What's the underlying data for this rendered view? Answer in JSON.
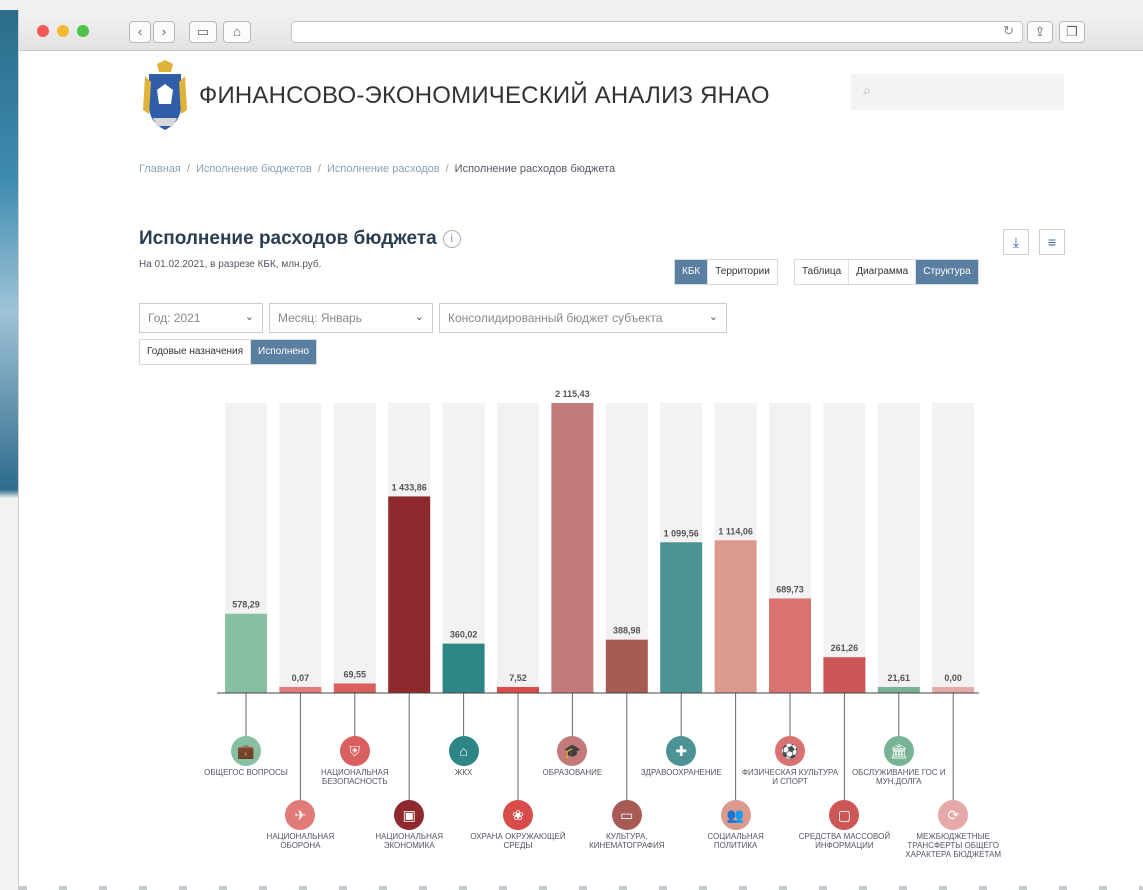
{
  "site": {
    "title": "ФИНАНСОВО-ЭКОНОМИЧЕСКИЙ АНАЛИЗ ЯНАО"
  },
  "breadcrumb": [
    "Главная",
    "Исполнение бюджетов",
    "Исполнение расходов",
    "Исполнение расходов бюджета"
  ],
  "page": {
    "title": "Исполнение расходов бюджета",
    "info": "i",
    "subtitle": "На 01.02.2021, в разрезе КБК, млн.руб."
  },
  "view_tabs": {
    "kbk": "КБК",
    "territories": "Территории"
  },
  "display_tabs": {
    "table": "Таблица",
    "diagram": "Диаграмма",
    "structure": "Структура"
  },
  "filters": {
    "year": "Год: 2021",
    "month": "Месяц: Январь",
    "budget": "Консолидированный бюджет субъекта"
  },
  "mode_tabs": {
    "plan": "Годовые назначения",
    "done": "Исполнено"
  },
  "icons": {
    "download": "download-icon",
    "menu": "list-icon",
    "search": "search-icon"
  },
  "chart_data": {
    "type": "bar",
    "categories": [
      "ОБЩЕГОС ВОПРОСЫ",
      "НАЦИОНАЛЬНАЯ ОБОРОНА",
      "НАЦИОНАЛЬНАЯ БЕЗОПАСНОСТЬ",
      "НАЦИОНАЛЬНАЯ ЭКОНОМИКА",
      "ЖКХ",
      "ОХРАНА ОКРУЖАЮЩЕЙ СРЕДЫ",
      "ОБРАЗОВАНИЕ",
      "КУЛЬТУРА, КИНЕМАТОГРАФИЯ",
      "ЗДРАВООХРАНЕНИЕ",
      "СОЦИАЛЬНАЯ ПОЛИТИКА",
      "ФИЗИЧЕСКАЯ КУЛЬТУРА И СПОРТ",
      "СРЕДСТВА МАССОВОЙ ИНФОРМАЦИИ",
      "ОБСЛУЖИВАНИЕ ГОС И МУН.ДОЛГА",
      "МЕЖБЮДЖЕТНЫЕ ТРАНСФЕРТЫ ОБЩЕГО ХАРАКТЕРА БЮДЖЕТАМ"
    ],
    "values": [
      578.29,
      0.07,
      69.55,
      1433.86,
      360.02,
      7.52,
      2115.43,
      388.98,
      1099.56,
      1114.06,
      689.73,
      261.26,
      21.61,
      0.0
    ],
    "value_labels": [
      "578,29",
      "0,07",
      "69,55",
      "1 433,86",
      "360,02",
      "7,52",
      "2 115,43",
      "388,98",
      "1 099,56",
      "1 114,06",
      "689,73",
      "261,26",
      "21,61",
      "0,00"
    ],
    "colors": [
      "#86bfa2",
      "#e07b78",
      "#d9605e",
      "#8e2a2e",
      "#2e8585",
      "#d84d4b",
      "#c27a7a",
      "#a85a55",
      "#4c9396",
      "#dc9a8e",
      "#db7272",
      "#cd5756",
      "#79b395",
      "#e5a9a7"
    ],
    "ymax": 2115.43
  }
}
